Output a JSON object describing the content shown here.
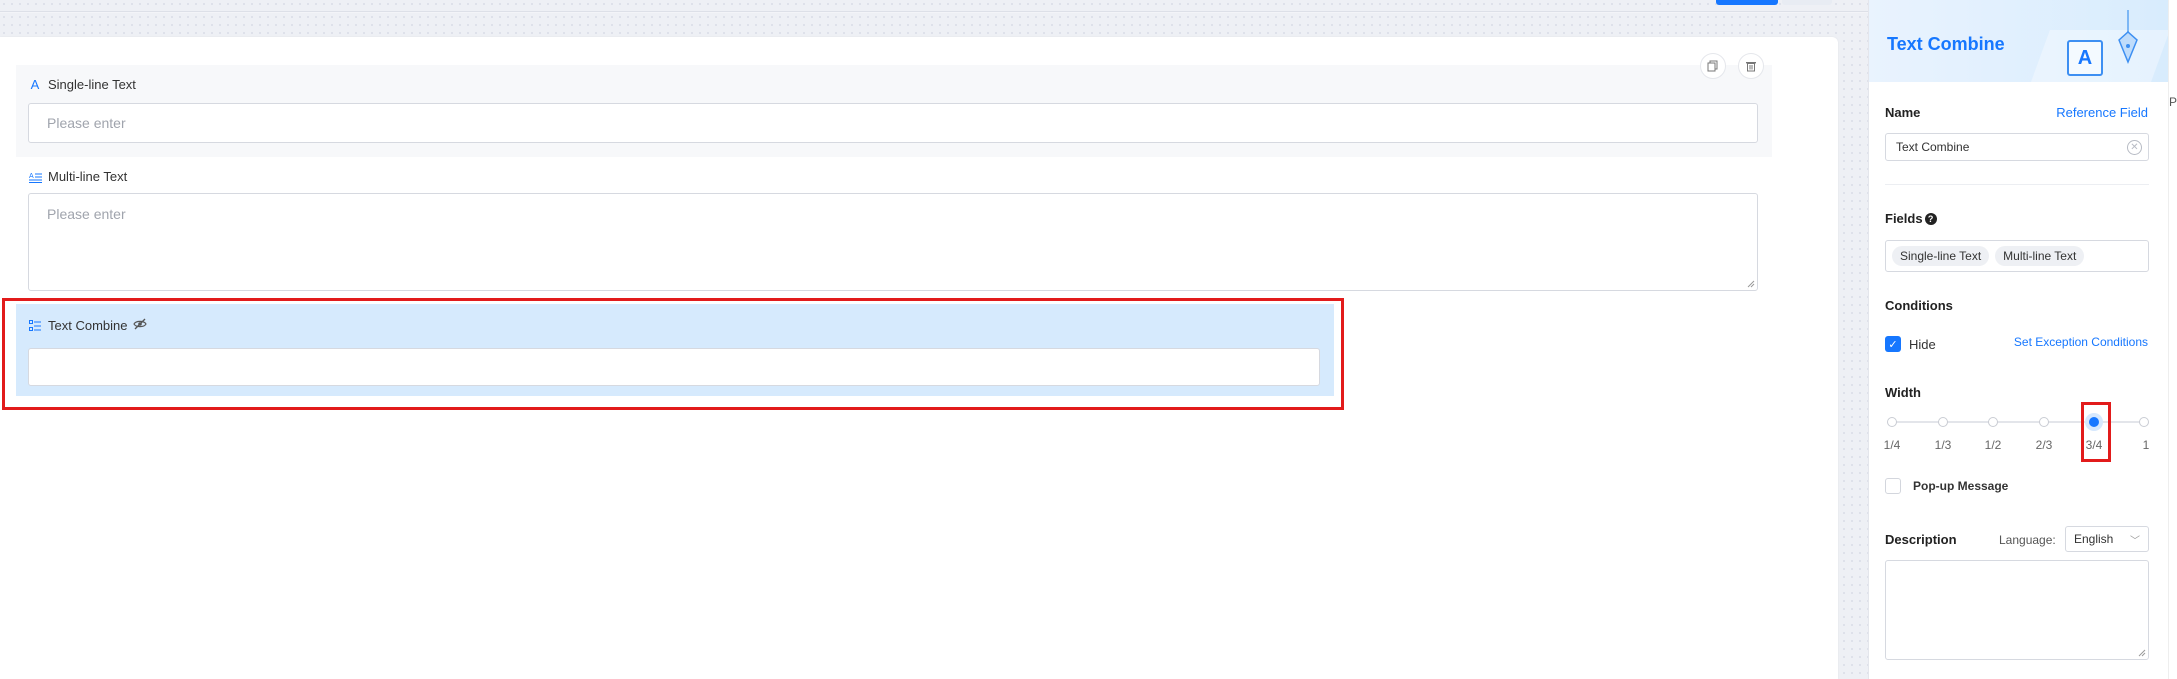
{
  "form": {
    "single_line": {
      "label": "Single-line Text",
      "placeholder": "Please enter"
    },
    "multi_line": {
      "label": "Multi-line Text",
      "placeholder": "Please enter"
    },
    "text_combine": {
      "label": "Text Combine",
      "value": ""
    }
  },
  "panel": {
    "title": "Text Combine",
    "name_label": "Name",
    "reference_field_link": "Reference Field",
    "name_value": "Text Combine",
    "fields_label": "Fields",
    "fields_tags": [
      "Single-line Text",
      "Multi-line Text"
    ],
    "conditions_label": "Conditions",
    "hide_label": "Hide",
    "set_exception_link": "Set Exception Conditions",
    "width_label": "Width",
    "width_marks": [
      "1/4",
      "1/3",
      "1/2",
      "2/3",
      "3/4",
      "1"
    ],
    "width_selected": "3/4",
    "popup_label": "Pop-up Message",
    "description_label": "Description",
    "language_label": "Language:",
    "language_value": "English"
  },
  "edge": {
    "text": "Pe"
  },
  "colors": {
    "accent": "#1677ff",
    "highlight_red": "#e21b1b",
    "selected_field_bg": "#d6eafd"
  }
}
